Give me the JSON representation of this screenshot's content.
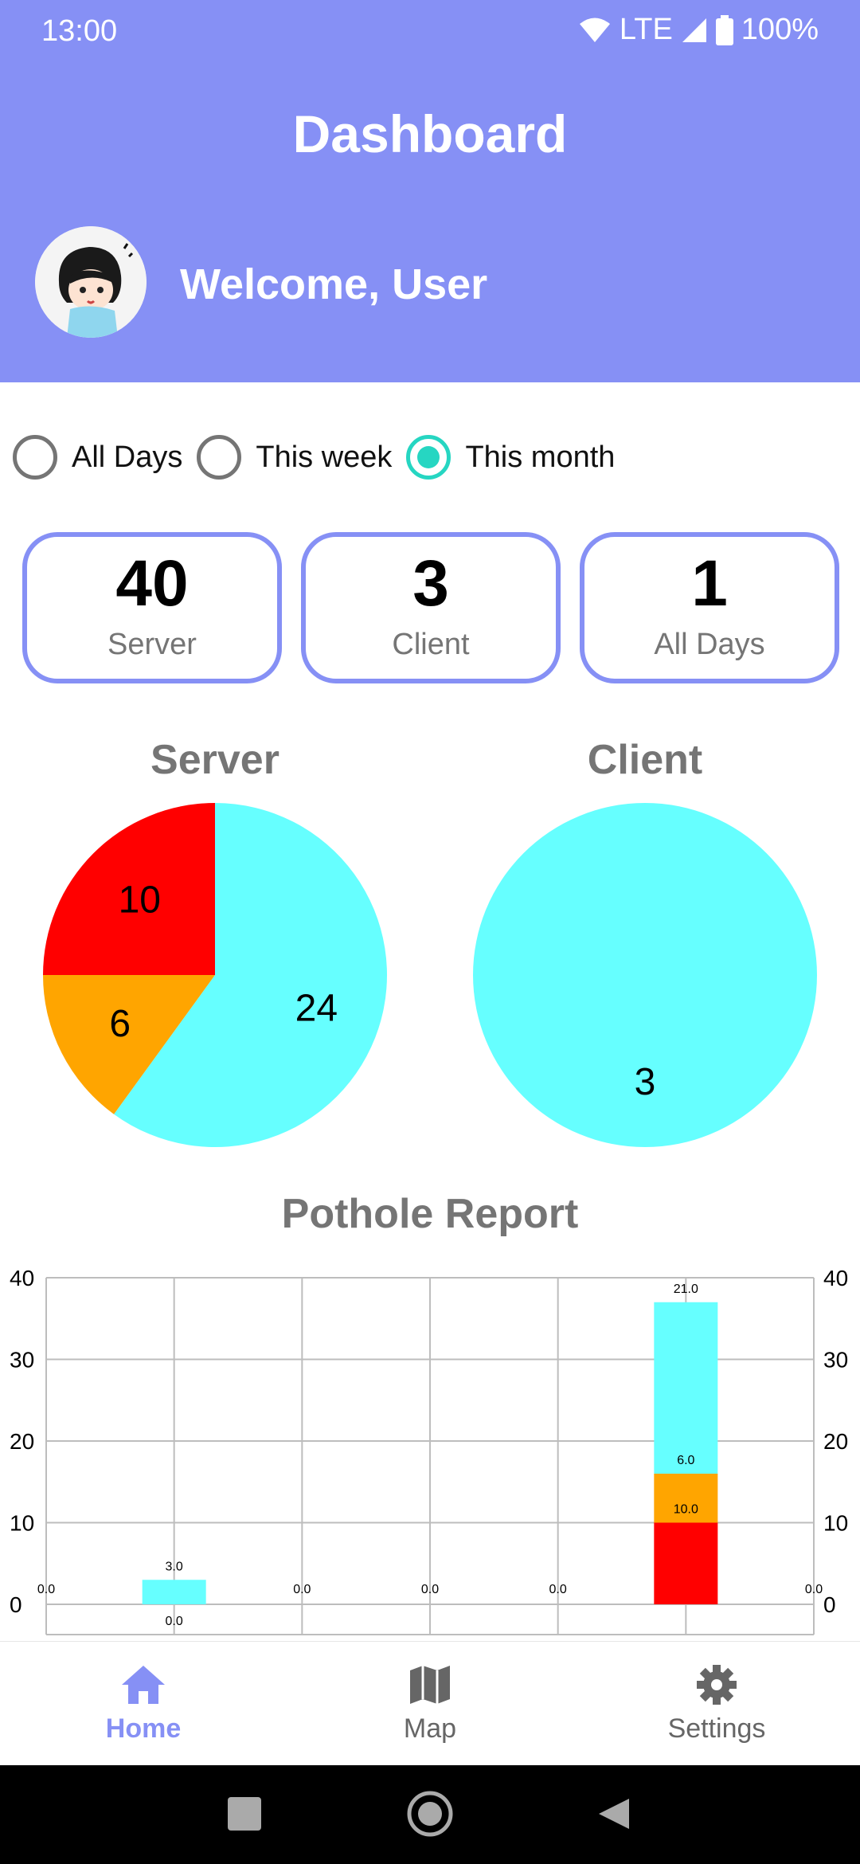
{
  "status_bar": {
    "time": "13:00",
    "network": "LTE",
    "battery": "100%"
  },
  "header": {
    "title": "Dashboard",
    "welcome": "Welcome, User"
  },
  "filters": {
    "options": [
      {
        "label": "All Days",
        "checked": false
      },
      {
        "label": "This week",
        "checked": false
      },
      {
        "label": "This month",
        "checked": true
      }
    ]
  },
  "stats": [
    {
      "value": "40",
      "label": "Server"
    },
    {
      "value": "3",
      "label": "Client"
    },
    {
      "value": "1",
      "label": "All Days"
    }
  ],
  "colors": {
    "accent": "#8690f5",
    "radio_checked": "#26d6c2",
    "cyan": "#66ffff",
    "orange": "#ffa500",
    "red": "#ff0000",
    "muted_text": "#757575"
  },
  "bottom_nav": {
    "items": [
      {
        "label": "Home",
        "icon": "home-icon",
        "active": true
      },
      {
        "label": "Map",
        "icon": "map-icon",
        "active": false
      },
      {
        "label": "Settings",
        "icon": "gear-icon",
        "active": false
      }
    ]
  },
  "chart_data": [
    {
      "type": "pie",
      "title": "Server",
      "slices": [
        {
          "value": 24,
          "label": "24",
          "color": "#66ffff"
        },
        {
          "value": 6,
          "label": "6",
          "color": "#ffa500"
        },
        {
          "value": 10,
          "label": "10",
          "color": "#ff0000"
        }
      ]
    },
    {
      "type": "pie",
      "title": "Client",
      "slices": [
        {
          "value": 3,
          "label": "3",
          "color": "#66ffff"
        }
      ]
    },
    {
      "type": "bar",
      "stacked": true,
      "title": "Pothole Report",
      "ylim": [
        0,
        40
      ],
      "yticks": [
        0,
        10,
        20,
        30,
        40
      ],
      "grid": true,
      "bars": [
        {
          "segments": [],
          "labels": [
            "0.0"
          ]
        },
        {
          "segments": [
            {
              "value": 3.0,
              "color": "#66ffff"
            }
          ],
          "labels": [
            "0.0",
            "3.0"
          ]
        },
        {
          "segments": [],
          "labels": [
            "0.0"
          ]
        },
        {
          "segments": [],
          "labels": [
            "0.0"
          ]
        },
        {
          "segments": [],
          "labels": [
            "0.0"
          ]
        },
        {
          "segments": [
            {
              "value": 10.0,
              "color": "#ff0000"
            },
            {
              "value": 6.0,
              "color": "#ffa500"
            },
            {
              "value": 21.0,
              "color": "#66ffff"
            }
          ],
          "labels": [
            "10.0",
            "6.0",
            "21.0"
          ]
        },
        {
          "segments": [],
          "labels": [
            "0.0"
          ]
        }
      ]
    }
  ]
}
